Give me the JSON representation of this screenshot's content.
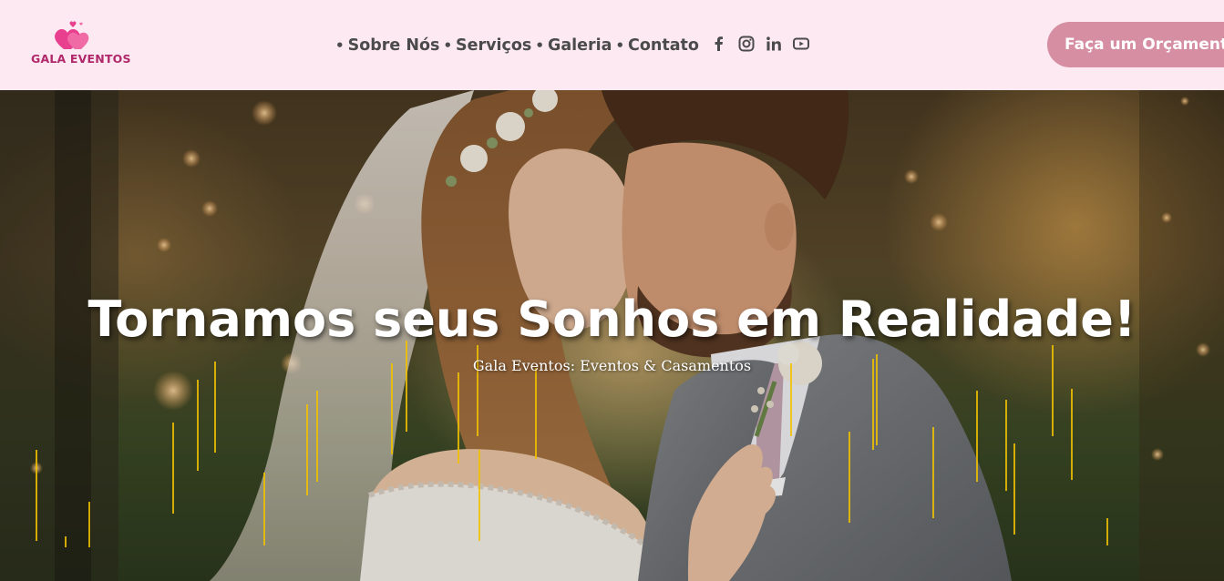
{
  "header": {
    "logo_text": "GALA EVENTOS",
    "nav": [
      {
        "label": "Sobre Nós"
      },
      {
        "label": "Serviços"
      },
      {
        "label": "Galeria"
      },
      {
        "label": "Contato"
      }
    ],
    "social": [
      "facebook-icon",
      "instagram-icon",
      "linkedin-icon",
      "youtube-icon"
    ],
    "cta_label": "Faça um Orçamento"
  },
  "hero": {
    "title": "Tornamos seus Sonhos em Realidade!",
    "subtitle": "Gala Eventos: Eventos & Casamentos",
    "image": "couple-photo"
  },
  "colors": {
    "header_bg": "#fde9f1",
    "cta_bg": "#d58ea2",
    "logo_pink": "#e83f8f",
    "nav_text": "#4b4b4b",
    "accent_lines": "#f2c200"
  }
}
